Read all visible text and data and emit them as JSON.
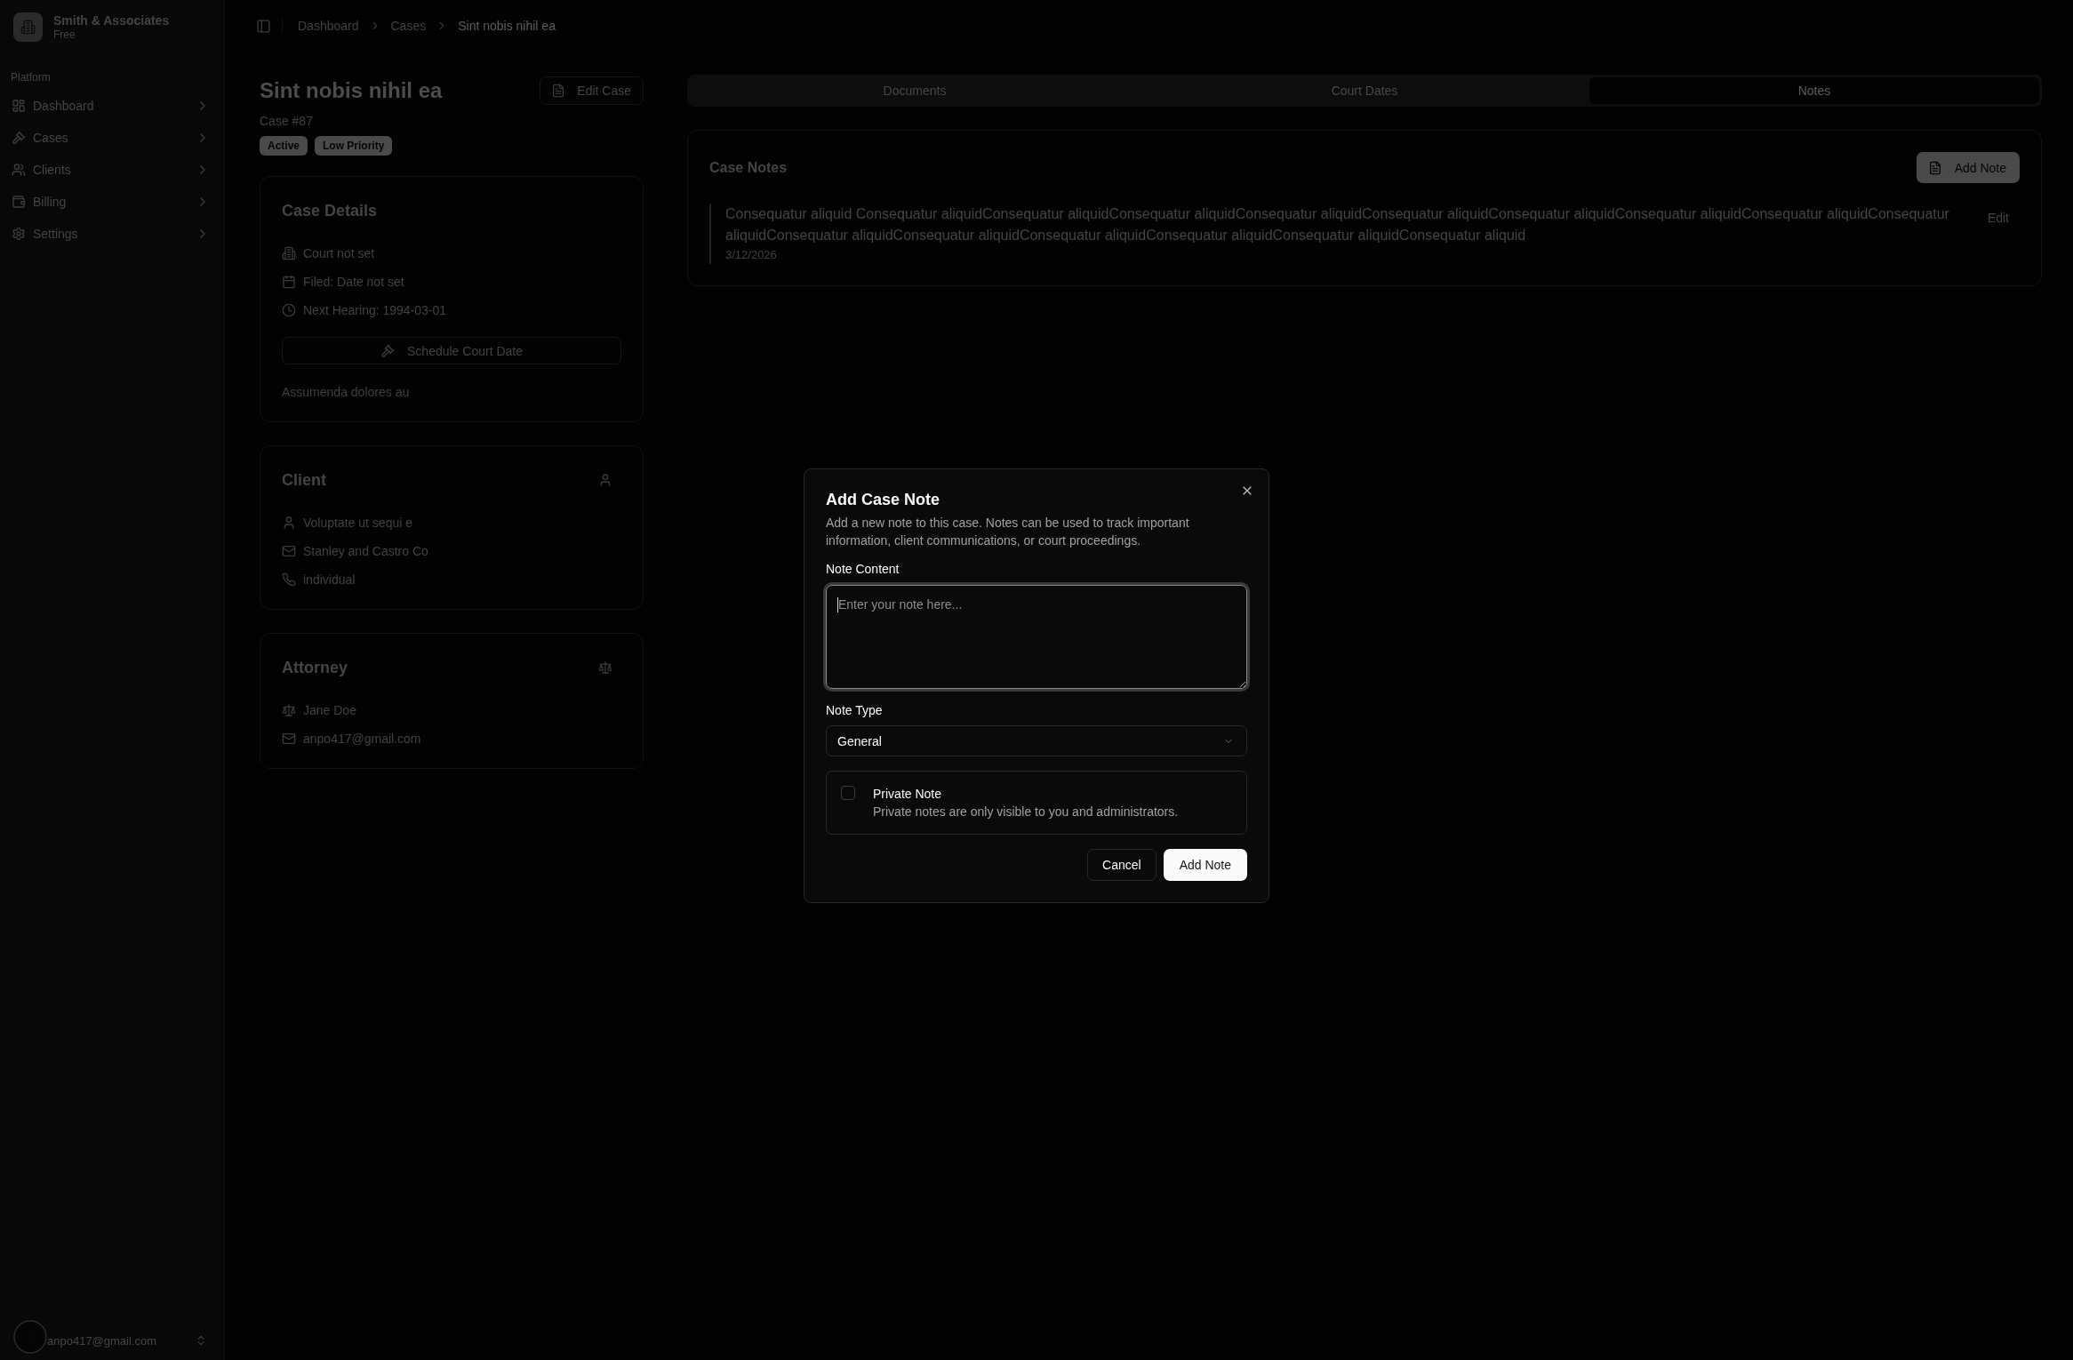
{
  "sidebar": {
    "team": {
      "name": "Smith & Associates",
      "plan": "Free"
    },
    "group_label": "Platform",
    "items": [
      {
        "kind": "dashboard",
        "label": "Dashboard"
      },
      {
        "kind": "cases",
        "label": "Cases"
      },
      {
        "kind": "clients",
        "label": "Clients"
      },
      {
        "kind": "billing",
        "label": "Billing"
      },
      {
        "kind": "settings",
        "label": "Settings"
      }
    ],
    "user": {
      "email": "anpo417@gmail.com"
    }
  },
  "breadcrumbs": [
    {
      "label": "Dashboard",
      "current": false
    },
    {
      "label": "Cases",
      "current": false
    },
    {
      "label": "Sint nobis nihil ea",
      "current": true
    }
  ],
  "case": {
    "title": "Sint nobis nihil ea",
    "edit_button": "Edit Case",
    "number": "Case #87",
    "badges": [
      "Active",
      "Low Priority"
    ]
  },
  "cards": [
    {
      "kind": "details",
      "title": "Case Details",
      "rows": [
        {
          "kind": "court",
          "text": "Court not set"
        },
        {
          "kind": "filed",
          "text": "Filed: Date not set"
        },
        {
          "kind": "hearing",
          "text": "Next Hearing: 1994-03-01"
        }
      ],
      "button": "Schedule Court Date",
      "description": "Assumenda dolores au"
    },
    {
      "kind": "client",
      "title": "Client",
      "rows": [
        {
          "kind": "person",
          "text": "Voluptate ut sequi e"
        },
        {
          "kind": "email",
          "text": "Stanley and Castro Co"
        },
        {
          "kind": "phone",
          "text": "individual"
        }
      ]
    },
    {
      "kind": "attorney",
      "title": "Attorney",
      "rows": [
        {
          "kind": "attorney",
          "text": "Jane Doe"
        },
        {
          "kind": "email",
          "text": "anpo417@gmail.com"
        }
      ]
    }
  ],
  "tabs": [
    {
      "label": "Documents",
      "selected": false
    },
    {
      "label": "Court Dates",
      "selected": false
    },
    {
      "label": "Notes",
      "selected": true
    }
  ],
  "notes_card": {
    "title": "Case Notes",
    "add_button": "Add Note",
    "notes": [
      {
        "text": "Consequatur aliquid Consequatur aliquidConsequatur aliquidConsequatur aliquidConsequatur aliquidConsequatur aliquidConsequatur aliquidConsequatur aliquidConsequatur aliquidConsequatur aliquidConsequatur aliquidConsequatur aliquidConsequatur aliquidConsequatur aliquidConsequatur aliquidConsequatur aliquid",
        "date": "3/12/2026",
        "edit_label": "Edit"
      }
    ]
  },
  "dialog": {
    "title": "Add Case Note",
    "description": "Add a new note to this case. Notes can be used to track important information, client communications, or court proceedings.",
    "note_content": {
      "label": "Note Content",
      "placeholder": "Enter your note here...",
      "focused": true
    },
    "note_type": {
      "label": "Note Type",
      "value": "General"
    },
    "private_note": {
      "label": "Private Note",
      "description": "Private notes are only visible to you and administrators.",
      "checked": false
    },
    "cancel_button": "Cancel",
    "submit_button": "Add Note"
  }
}
